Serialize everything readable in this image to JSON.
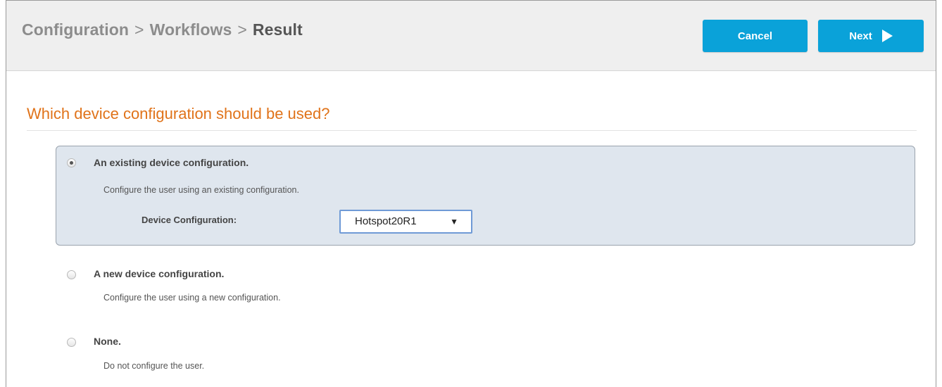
{
  "breadcrumb": {
    "items": [
      "Configuration",
      "Workflows"
    ],
    "separator": ">",
    "current": "Result"
  },
  "actions": {
    "cancel_label": "Cancel",
    "next_label": "Next"
  },
  "question": "Which device configuration should be used?",
  "options": [
    {
      "title": "An existing device configuration.",
      "description": "Configure the user using an existing configuration.",
      "selected": true
    },
    {
      "title": "A new device configuration.",
      "description": "Configure the user using a new configuration.",
      "selected": false
    },
    {
      "title": "None.",
      "description": "Do not configure the user.",
      "selected": false
    }
  ],
  "device_configuration": {
    "label": "Device Configuration:",
    "value": "Hotspot20R1"
  },
  "colors": {
    "accent_button": "#0aa2d9",
    "question_text": "#e0731a",
    "selected_panel": "#dfe6ee"
  }
}
